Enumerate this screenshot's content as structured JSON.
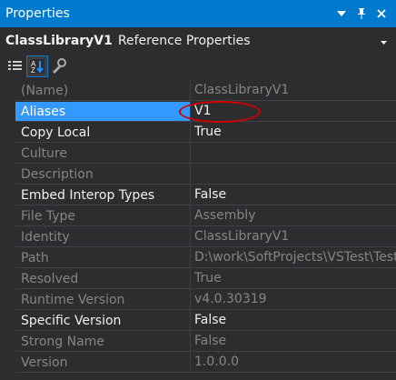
{
  "window": {
    "title": "Properties",
    "accent": "#007acc"
  },
  "object": {
    "name": "ClassLibraryV1",
    "type": "Reference Properties"
  },
  "toolbar": {
    "icons": [
      "categorized-icon",
      "alphabetical-icon",
      "property-pages-icon"
    ]
  },
  "properties": [
    {
      "name": "(Name)",
      "value": "ClassLibraryV1",
      "dim": true
    },
    {
      "name": "Aliases",
      "value": "V1",
      "selected": true
    },
    {
      "name": "Copy Local",
      "value": "True"
    },
    {
      "name": "Culture",
      "value": "",
      "dim": true
    },
    {
      "name": "Description",
      "value": "",
      "dim": true
    },
    {
      "name": "Embed Interop Types",
      "value": "False"
    },
    {
      "name": "File Type",
      "value": "Assembly",
      "dim": true
    },
    {
      "name": "Identity",
      "value": "ClassLibraryV1",
      "dim": true
    },
    {
      "name": "Path",
      "value": "D:\\work\\SoftProjects\\VSTest\\Test",
      "dim": true
    },
    {
      "name": "Resolved",
      "value": "True",
      "dim": true
    },
    {
      "name": "Runtime Version",
      "value": "v4.0.30319",
      "dim": true
    },
    {
      "name": "Specific Version",
      "value": "False"
    },
    {
      "name": "Strong Name",
      "value": "False",
      "dim": true
    },
    {
      "name": "Version",
      "value": "1.0.0.0",
      "dim": true
    }
  ]
}
